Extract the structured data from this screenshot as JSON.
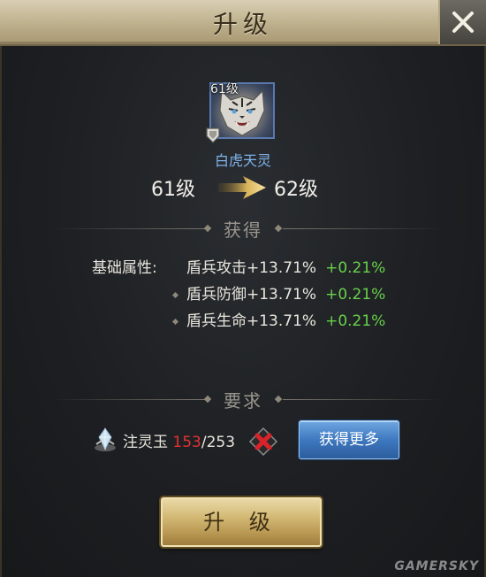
{
  "window": {
    "title": "升级"
  },
  "hero": {
    "portrait_level": "61级",
    "name": "白虎天灵",
    "level_from": "61级",
    "level_to": "62级"
  },
  "gain_section": {
    "header": "获得",
    "base_attr_label": "基础属性:",
    "rows": [
      {
        "text": "盾兵攻击+13.71%",
        "bonus": "+0.21%"
      },
      {
        "text": "盾兵防御+13.71%",
        "bonus": "+0.21%"
      },
      {
        "text": "盾兵生命+13.71%",
        "bonus": "+0.21%"
      }
    ]
  },
  "require_section": {
    "header": "要求",
    "item_name": "注灵玉",
    "have": "153",
    "need": "/253",
    "get_more_label": "获得更多"
  },
  "buttons": {
    "upgrade_label": "升 级"
  },
  "watermark": "GAMERSKY",
  "colors": {
    "bonus": "#68d14a",
    "insufficient": "#e23232",
    "hero_name": "#7fb3ec",
    "gold": "#d2b873"
  },
  "icons": {
    "close": "close-icon",
    "arrow": "arrow-right-icon",
    "gem": "gem-icon",
    "unavailable": "x-mark-icon",
    "rank": "shield-badge-icon"
  }
}
